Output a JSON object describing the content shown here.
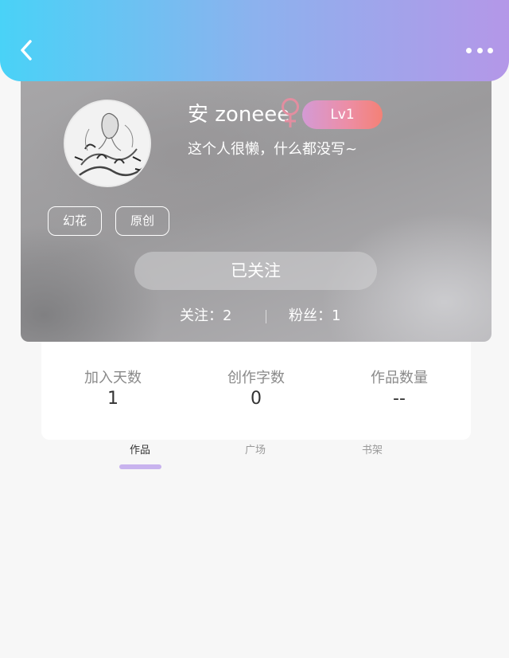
{
  "header": {
    "back_icon": "chevron-left-icon",
    "more_icon": "more-dots-icon",
    "colors": {
      "gradient_start": "#49d2f7",
      "gradient_end": "#b497e8"
    }
  },
  "profile": {
    "username": "安 zoneee",
    "gender_icon": "female-icon",
    "level": "Lv1",
    "bio": "这个人很懒，什么都没写~",
    "tags": [
      "幻花",
      "原创"
    ],
    "follow_button": "已关注",
    "following_text": "关注：2",
    "fans_text": "粉丝：1"
  },
  "stats": [
    {
      "label": "加入天数",
      "value": "1"
    },
    {
      "label": "创作字数",
      "value": "0"
    },
    {
      "label": "作品数量",
      "value": "--"
    }
  ],
  "tabs": [
    {
      "label": "作品",
      "active": true
    },
    {
      "label": "广场",
      "active": false
    },
    {
      "label": "书架",
      "active": false
    }
  ],
  "colors": {
    "level_badge": "#ec8ea7",
    "gender": "#e28ea0",
    "tab_indicator": "#c8b3ee"
  }
}
